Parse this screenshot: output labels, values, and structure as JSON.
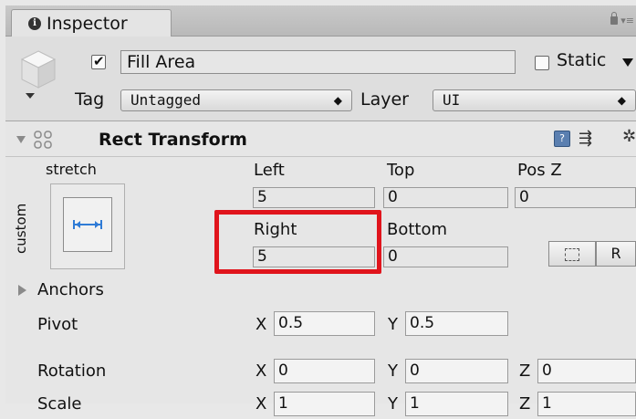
{
  "tab": {
    "title": "Inspector"
  },
  "object": {
    "active": true,
    "name": "Fill Area",
    "static_label": "Static"
  },
  "tag": {
    "label": "Tag",
    "value": "Untagged"
  },
  "layer": {
    "label": "Layer",
    "value": "UI"
  },
  "component": {
    "title": "Rect Transform",
    "anchor_preset_label": "stretch",
    "anchor_side_label": "custom",
    "labels": {
      "left": "Left",
      "top": "Top",
      "posz": "Pos Z",
      "right": "Right",
      "bottom": "Bottom"
    },
    "values": {
      "left": "5",
      "top": "0",
      "posz": "0",
      "right": "5",
      "bottom": "0"
    },
    "raw_edit_button": "R",
    "anchors_label": "Anchors",
    "pivot": {
      "label": "Pivot",
      "x": "0.5",
      "y": "0.5"
    },
    "rotation": {
      "label": "Rotation",
      "x": "0",
      "y": "0",
      "z": "0"
    },
    "scale": {
      "label": "Scale",
      "x": "1",
      "y": "1",
      "z": "1"
    },
    "axis": {
      "x": "X",
      "y": "Y",
      "z": "Z"
    }
  },
  "colors": {
    "highlight": "#e0141c"
  }
}
